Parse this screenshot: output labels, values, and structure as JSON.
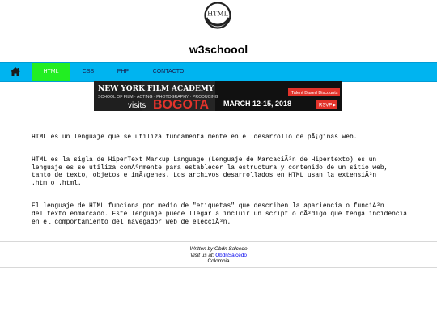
{
  "logo": {
    "text": "HTML",
    "icon": "html-logo-icon"
  },
  "site": {
    "title": "w3schoool"
  },
  "nav": {
    "home_icon": "home-icon",
    "items": [
      {
        "label": "HTML",
        "active": true
      },
      {
        "label": "CSS",
        "active": false
      },
      {
        "label": "PHP",
        "active": false
      },
      {
        "label": "CONTACTO",
        "active": false
      }
    ]
  },
  "banner": {
    "line1": "NEW YORK FILM ACADEMY",
    "line2": "SCHOOL OF FILM · ACTING · PHOTOGRAPHY · PRODUCING",
    "visits": "visits",
    "city": "BOGOTA",
    "dates": "MARCH 12-15, 2018",
    "discount": "Talent Based Discounts",
    "rsvp": "RSVP ▸"
  },
  "content": {
    "p1": "HTML es un lenguaje que se utiliza fundamentalmente en el desarrollo de pÃ¡ginas web.",
    "p2": "HTML es la sigla de HiperText Markup Language (Lenguaje de MarcaciÃ³n de Hipertexto) es un\nlenguaje es se utiliza comÃºnmente para establecer la estructura y contenido de un sitio web,\ntanto de texto, objetos e imÃ¡genes. Los archivos desarrollados en HTML usan la extensiÃ³n\n.htm o .html.",
    "p3": "El lenguaje de HTML funciona por medio de \"etiquetas\" que describen la apariencia o funciÃ³n\ndel texto enmarcado. Este lenguaje puede llegar a incluir un script o cÃ³digo que tenga incidencia\nen el comportamiento del navegador web de elecciÃ³n."
  },
  "footer": {
    "written_by": "Written by Obdn Salcedo",
    "visit_prefix": "Visit us at: ",
    "visit_link": "ObdnSalcedo",
    "country": "Colombia"
  },
  "colors": {
    "nav_bg": "#00b4f0",
    "nav_active": "#22ee22",
    "banner_bg": "#111111",
    "banner_accent": "#e3332b"
  }
}
